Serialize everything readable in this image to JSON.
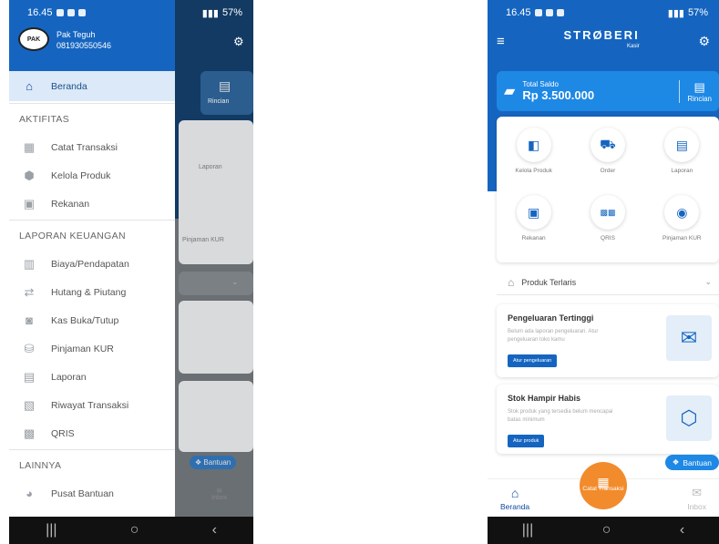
{
  "left": {
    "status": {
      "time": "16.45",
      "battery": "57%"
    },
    "user": {
      "name": "Pak Teguh",
      "phone": "081930550546",
      "avatar_text": "PAK"
    },
    "menu": {
      "home": "Beranda",
      "aktifitas_title": "AKTIFITAS",
      "aktifitas": [
        "Catat Transaksi",
        "Kelola Produk",
        "Rekanan"
      ],
      "laporan_title": "LAPORAN KEUANGAN",
      "laporan": [
        "Biaya/Pendapatan",
        "Hutang & Piutang",
        "Kas Buka/Tutup",
        "Pinjaman KUR",
        "Laporan",
        "Riwayat Transaksi",
        "QRIS"
      ],
      "lainnya_title": "LAINNYA",
      "lainnya": [
        "Pusat Bantuan"
      ]
    },
    "background": {
      "rincian": "Rincian",
      "laporan": "Laporan",
      "pinjaman": "Pinjaman KUR",
      "bantuan": "Bantuan",
      "inbox": "Inbox"
    }
  },
  "right": {
    "status": {
      "time": "16.45",
      "battery": "57%"
    },
    "brand": {
      "name": "STRØBERI",
      "sub": "Kasir"
    },
    "saldo": {
      "label": "Total Saldo",
      "amount": "Rp 3.500.000",
      "rincian": "Rincian"
    },
    "grid": [
      "Kelola Produk",
      "Order",
      "Laporan",
      "Rekanan",
      "QRIS",
      "Pinjaman KUR"
    ],
    "produk_terlaris": "Produk Terlaris",
    "pengeluaran": {
      "title": "Pengeluaran Tertinggi",
      "desc": "Belum ada laporan pengeluaran. Atur pengeluaran toko kamu",
      "button": "Atur pengeluaran"
    },
    "stok": {
      "title": "Stok Hampir Habis",
      "desc": "Stok produk yang tersedia belum mencapai batas minimum",
      "button": "Atur produk"
    },
    "bantuan": "Bantuan",
    "nav": {
      "home": "Beranda",
      "fab": "Catat Transaksi",
      "inbox": "Inbox"
    }
  },
  "colors": {
    "primary": "#1565c0",
    "accent": "#f28b2c",
    "highlight": "#dbe9f8"
  },
  "icons": {
    "home": "home-icon",
    "settings": "gear-icon",
    "menu": "hamburger-icon"
  }
}
